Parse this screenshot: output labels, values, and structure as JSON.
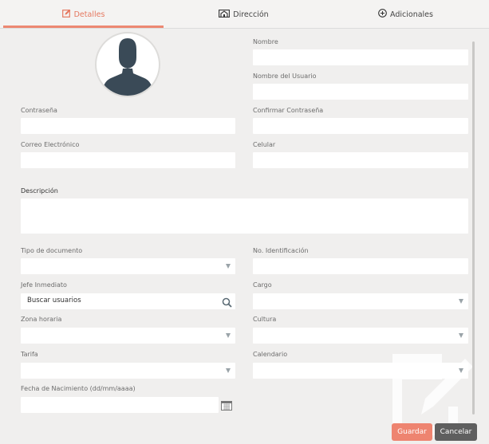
{
  "tabs": [
    {
      "label": "Detalles",
      "icon": "edit-icon",
      "active": true
    },
    {
      "label": "Dirección",
      "icon": "home-icon",
      "active": false
    },
    {
      "label": "Adicionales",
      "icon": "plus-circle-icon",
      "active": false
    }
  ],
  "form": {
    "nombre": "Nombre",
    "nombre_usuario": "Nombre del Usuario",
    "contrasena": "Contraseña",
    "confirmar_contrasena": "Confirmar Contraseña",
    "correo": "Correo Electrónico",
    "celular": "Celular",
    "descripcion": "Descripción",
    "tipo_documento": "Tipo de documento",
    "no_identificacion": "No. Identificación",
    "jefe_inmediato": "Jefe Inmediato",
    "jefe_placeholder": "Buscar usuarios",
    "cargo": "Cargo",
    "zona_horaria": "Zona horaria",
    "cultura": "Cultura",
    "tarifa": "Tarifa",
    "calendario": "Calendario",
    "fecha_nacimiento": "Fecha de Nacimiento (dd/mm/aaaa)"
  },
  "buttons": {
    "guardar": "Guardar",
    "cancelar": "Cancelar"
  },
  "colors": {
    "accent": "#ec8872",
    "save_button": "#ee8470",
    "cancel_button": "#5f5f5f",
    "background": "#f0efee"
  }
}
